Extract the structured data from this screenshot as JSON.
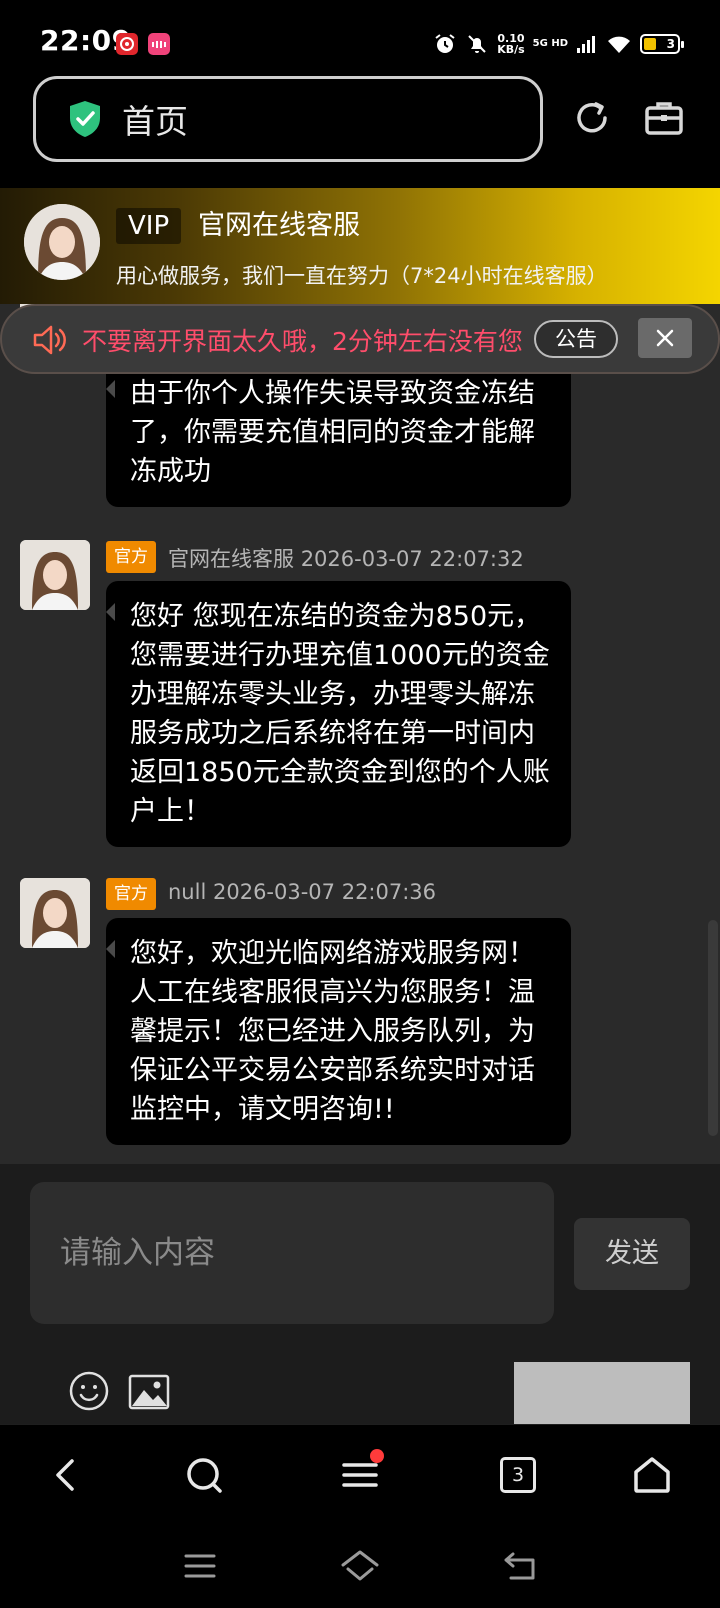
{
  "status_bar": {
    "time": "22:09",
    "speed_value": "0.10",
    "speed_unit": "KB/s",
    "network": "5G HD",
    "battery_level": "3",
    "battery_color": "#f2c200",
    "icons": [
      "netease-music-icon",
      "app-icon",
      "alarm-icon",
      "mute-icon",
      "signal-icon",
      "wifi-icon",
      "battery-icon"
    ]
  },
  "address_bar": {
    "title": "首页",
    "icons": [
      "shield-check-icon",
      "refresh-icon",
      "toolbox-icon"
    ]
  },
  "vip_banner": {
    "badge": "VIP",
    "title": "官网在线客服",
    "subtitle": "用心做服务，我们一直在努力（7*24小时在线客服）"
  },
  "notice": {
    "text": "不要离开界面太久哦，2分钟左右没有您",
    "pill": "公告",
    "text_color": "#ff4d6b"
  },
  "messages": [
    {
      "text": "由于你个人操作失误导致资金冻结了，你需要充值相同的资金才能解冻成功"
    },
    {
      "tag": "官方",
      "sender": "官网在线客服",
      "timestamp": "2026-03-07 22:07:32",
      "text": "您好 您现在冻结的资金为850元，您需要进行办理充值1000元的资金办理解冻零头业务，办理零头解冻服务成功之后系统将在第一时间内返回1850元全款资金到您的个人账户上！"
    },
    {
      "tag": "官方",
      "sender": "null",
      "timestamp": "2026-03-07 22:07:36",
      "text": "您好，欢迎光临网络游戏服务网！人工在线客服很高兴为您服务！温馨提示！您已经进入服务队列，为保证公平交易公安部系统实时对话监控中，请文明咨询!!"
    }
  ],
  "input": {
    "placeholder": "请输入内容",
    "send_label": "发送"
  },
  "browser_nav": {
    "tab_count": "3",
    "icons": [
      "back-icon",
      "search-icon",
      "menu-icon",
      "tabs-icon",
      "home-icon"
    ]
  },
  "accent_colors": {
    "tag": "#f08a00",
    "vip_gradient_end": "#f4d500",
    "shield": "#2ec27e"
  }
}
